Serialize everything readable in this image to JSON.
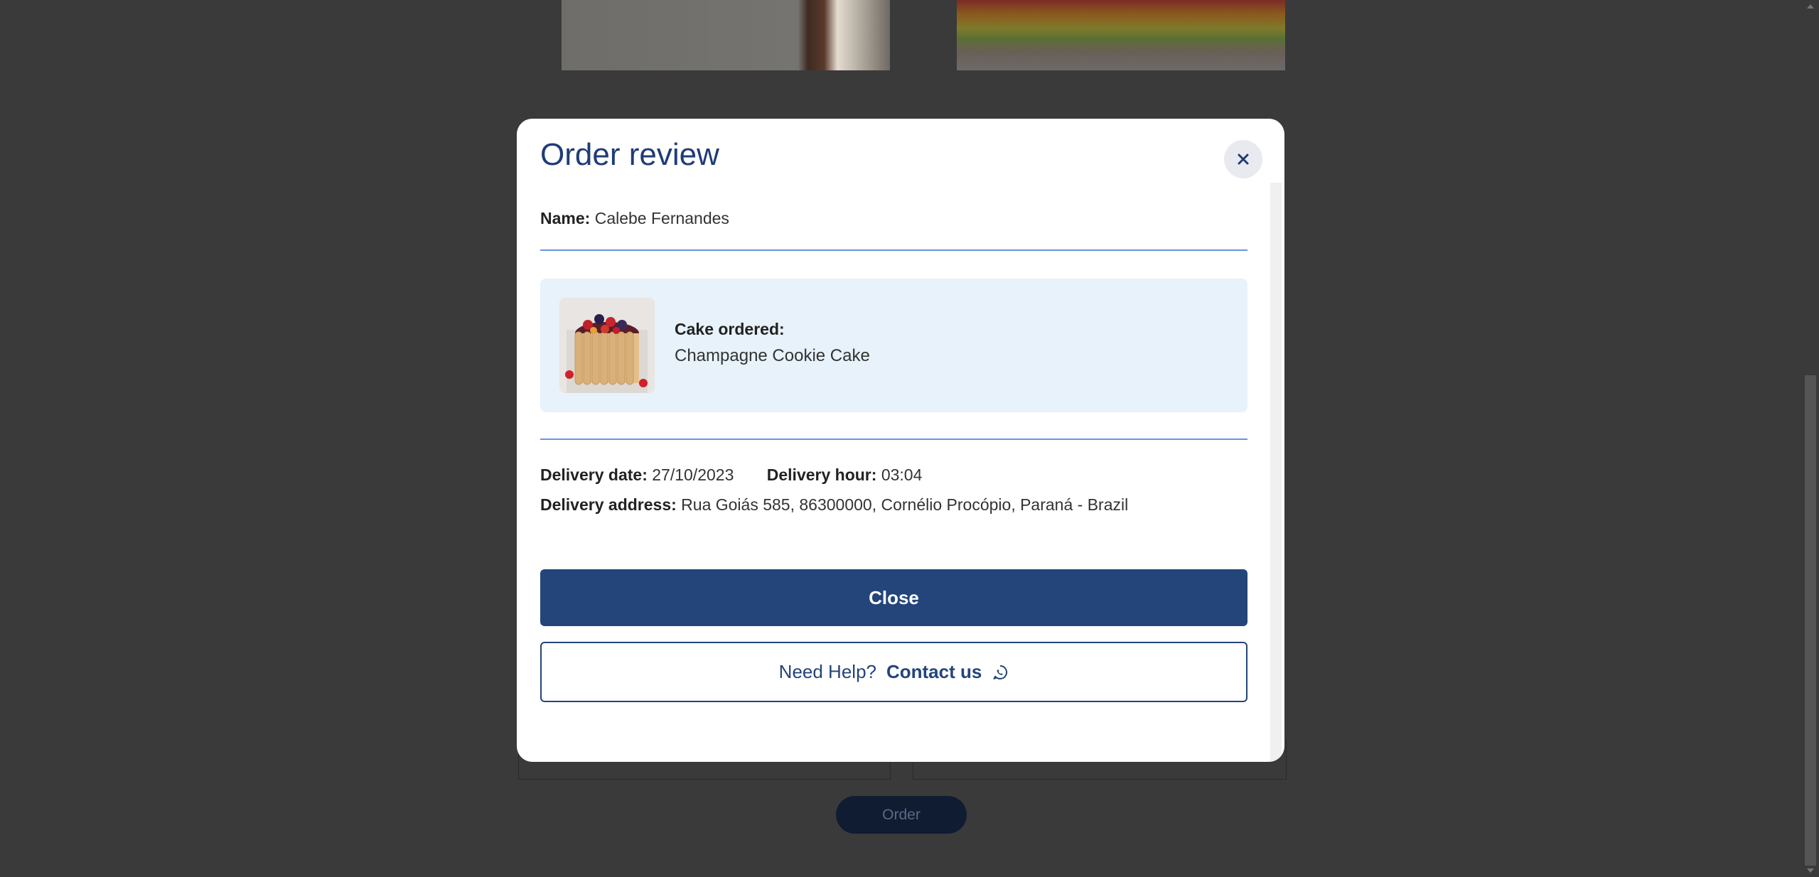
{
  "background": {
    "order_button_label": "Order"
  },
  "modal": {
    "title": "Order review",
    "name_label": "Name:",
    "name_value": "Calebe Fernandes",
    "cake_label": "Cake ordered:",
    "cake_value": "Champagne Cookie Cake",
    "delivery_date_label": "Delivery date:",
    "delivery_date_value": "27/10/2023",
    "delivery_hour_label": "Delivery hour:",
    "delivery_hour_value": "03:04",
    "delivery_address_label": "Delivery address:",
    "delivery_address_value": "Rua Goiás 585, 86300000, Cornélio Procópio, Paraná - Brazil",
    "close_button_label": "Close",
    "help_text": "Need Help?",
    "contact_label": "Contact us",
    "close_icon": "close-icon",
    "contact_icon": "whatsapp-icon"
  },
  "colors": {
    "primary": "#23457a",
    "title": "#1f3c78",
    "card_background": "#e7f2fa",
    "overlay": "#3a3a3a"
  }
}
